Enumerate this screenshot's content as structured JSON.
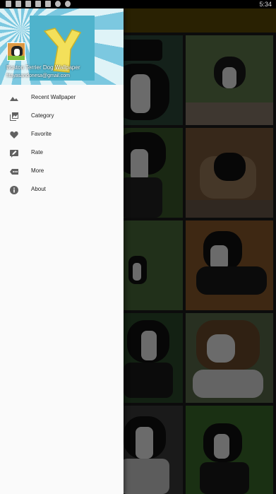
{
  "status_bar": {
    "time": "5:34",
    "icons": [
      "notification-icon",
      "notification-icon",
      "notification-icon",
      "notification-icon",
      "notification-icon",
      "instagram-icon",
      "instagram-icon"
    ]
  },
  "drawer": {
    "header": {
      "app_name": "Boston Terrier Dog Wallpaper",
      "email": "fitayasandonesa@gmail.com",
      "avatar": "app-avatar"
    },
    "menu_items": [
      {
        "label": "Recent Wallpaper",
        "icon": "landscape-icon"
      },
      {
        "label": "Category",
        "icon": "collections-icon"
      },
      {
        "label": "Favorite",
        "icon": "heart-icon"
      },
      {
        "label": "Rate",
        "icon": "rate-icon"
      },
      {
        "label": "More",
        "icon": "more-icon"
      },
      {
        "label": "About",
        "icon": "info-icon"
      }
    ]
  },
  "colors": {
    "app_bar": "#5b4a06",
    "drawer_bg": "#fafafa",
    "icon": "#616161"
  }
}
